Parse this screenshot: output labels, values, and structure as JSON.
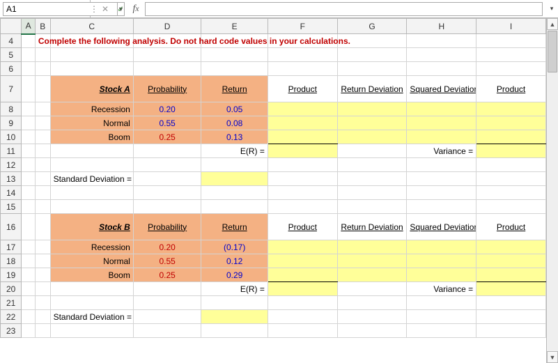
{
  "name_box": {
    "value": "A1"
  },
  "formula": {
    "value": ""
  },
  "instruction": "Complete the following analysis. Do not hard code values in your calculations.",
  "columns": [
    "A",
    "B",
    "C",
    "D",
    "E",
    "F",
    "G",
    "H",
    "I"
  ],
  "row_labels": [
    "4",
    "5",
    "6",
    "7",
    "8",
    "9",
    "10",
    "11",
    "12",
    "13",
    "14",
    "15",
    "16",
    "17",
    "18",
    "19",
    "20",
    "21",
    "22",
    "23"
  ],
  "headers": {
    "probability": "Probability",
    "return": "Return",
    "product": "Product",
    "ret_dev": "Return Deviation",
    "sq_dev": "Squared Deviation",
    "product2": "Product",
    "er": "E(R) =",
    "variance": "Variance =",
    "stddev": "Standard Deviation ="
  },
  "stockA": {
    "name": "Stock A",
    "rows": [
      {
        "state": "Recession",
        "p": "0.20",
        "r": "0.05"
      },
      {
        "state": "Normal",
        "p": "0.55",
        "r": "0.08"
      },
      {
        "state": "Boom",
        "p": "0.25",
        "r": "0.13"
      }
    ]
  },
  "stockB": {
    "name": "Stock B",
    "rows": [
      {
        "state": "Recession",
        "p": "0.20",
        "r": "(0.17)"
      },
      {
        "state": "Normal",
        "p": "0.55",
        "r": "0.12"
      },
      {
        "state": "Boom",
        "p": "0.25",
        "r": "0.29"
      }
    ]
  }
}
